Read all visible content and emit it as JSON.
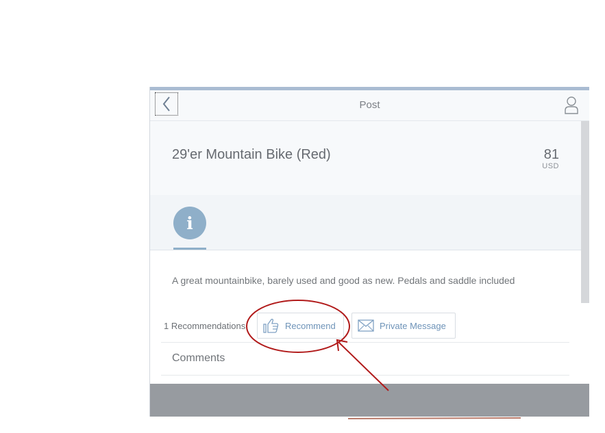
{
  "header": {
    "title": "Post",
    "back_icon": "chevron-left-icon",
    "user_icon": "user-icon"
  },
  "post": {
    "title": "29'er Mountain Bike (Red)",
    "price": "81",
    "currency": "USD",
    "description": "A great mountainbike, barely used and good as new. Pedals and saddle included"
  },
  "tabs": [
    {
      "icon": "info-icon",
      "glyph": "i",
      "selected": true
    }
  ],
  "actions": {
    "recommendations_count": "1 Recommendations",
    "recommend_label": "Recommend",
    "recommend_icon": "thumbs-up-icon",
    "message_label": "Private Message",
    "message_icon": "envelope-icon"
  },
  "comments": {
    "title": "Comments"
  },
  "colors": {
    "accent": "#8fafc9",
    "link": "#6e93b8",
    "annotation": "#b11a1a",
    "footer": "#979ba0"
  }
}
